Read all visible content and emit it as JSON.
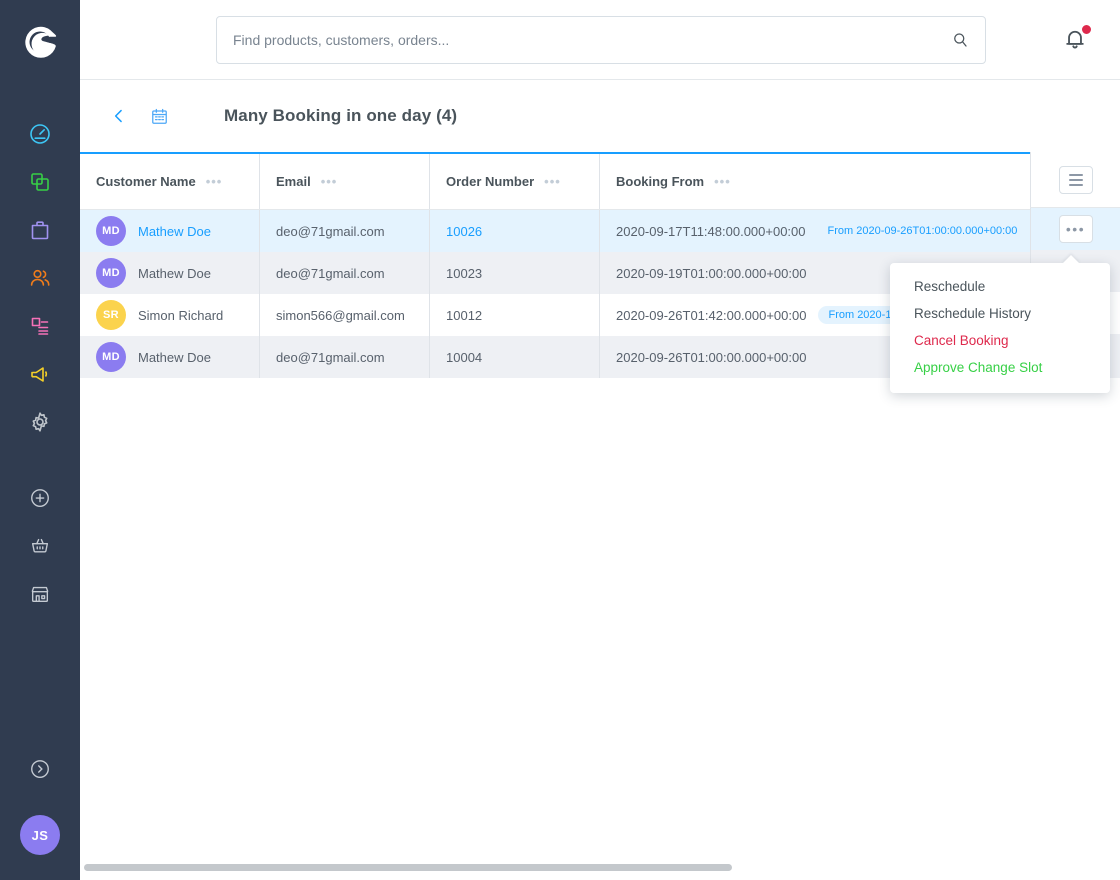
{
  "sidebar": {
    "logo_name": "shopware-logo",
    "items": [
      {
        "name": "dashboard-icon",
        "color": "#3dc6f5"
      },
      {
        "name": "catalogues-icon",
        "color": "#37d046"
      },
      {
        "name": "orders-bag-icon",
        "color": "#a092f0"
      },
      {
        "name": "customers-icon",
        "color": "#ef7c1b"
      },
      {
        "name": "content-list-icon",
        "color": "#f571b8"
      },
      {
        "name": "marketing-megaphone-icon",
        "color": "#f5d028"
      },
      {
        "name": "settings-gear-icon",
        "color": "#c0c6cc"
      },
      {
        "name": "add-plus-icon",
        "color": "#c0c6cc"
      },
      {
        "name": "basket-icon",
        "color": "#c0c6cc"
      },
      {
        "name": "store-icon",
        "color": "#c0c6cc"
      }
    ],
    "collapse_icon": "chevron-right-circle-icon",
    "user_initials": "JS",
    "user_avatar_color": "#8b7cf0"
  },
  "topbar": {
    "search_placeholder": "Find products, customers, orders...",
    "search_value": "",
    "search_icon": "search-icon",
    "notification_icon": "bell-icon",
    "notification_dot_color": "#de294c"
  },
  "page_header": {
    "back_icon": "chevron-left-icon",
    "calendar_icon": "calendar-icon",
    "title": "Many Booking in one day (4)"
  },
  "table": {
    "columns": [
      {
        "label": "Customer Name",
        "menu": "•••"
      },
      {
        "label": "Email",
        "menu": "•••"
      },
      {
        "label": "Order Number",
        "menu": "•••"
      },
      {
        "label": "Booking From",
        "menu": "•••"
      }
    ],
    "settings_button_icon": "table-settings-hamburger-icon",
    "row_action_icon": "row-actions-dots-icon",
    "rows": [
      {
        "initials": "MD",
        "avatar_color": "#8b7cf0",
        "name": "Mathew Doe",
        "email": "deo@71gmail.com",
        "order_number": "10026",
        "booking_from": "2020-09-17T11:48:00.000+00:00",
        "badge": "From 2020-09-26T01:00:00.000+00:00",
        "selected": true
      },
      {
        "initials": "MD",
        "avatar_color": "#8b7cf0",
        "name": "Mathew Doe",
        "email": "deo@71gmail.com",
        "order_number": "10023",
        "booking_from": "2020-09-19T01:00:00.000+00:00",
        "badge": "",
        "selected": false
      },
      {
        "initials": "SR",
        "avatar_color": "#fbd34d",
        "name": "Simon Richard",
        "email": "simon566@gmail.com",
        "order_number": "10012",
        "booking_from": "2020-09-26T01:42:00.000+00:00",
        "badge": "From 2020-10-1",
        "selected": false
      },
      {
        "initials": "MD",
        "avatar_color": "#8b7cf0",
        "name": "Mathew Doe",
        "email": "deo@71gmail.com",
        "order_number": "10004",
        "booking_from": "2020-09-26T01:00:00.000+00:00",
        "badge": "",
        "selected": false
      }
    ]
  },
  "context_menu": {
    "items": [
      {
        "label": "Reschedule",
        "style": "default"
      },
      {
        "label": "Reschedule History",
        "style": "default"
      },
      {
        "label": "Cancel Booking",
        "style": "danger"
      },
      {
        "label": "Approve Change Slot",
        "style": "success"
      }
    ]
  },
  "colors": {
    "sidebar_bg": "#303c50",
    "accent_blue": "#189eff",
    "danger": "#de294c",
    "success": "#37d046",
    "row_selected": "#e4f3fe",
    "row_alt": "#eef0f4"
  }
}
